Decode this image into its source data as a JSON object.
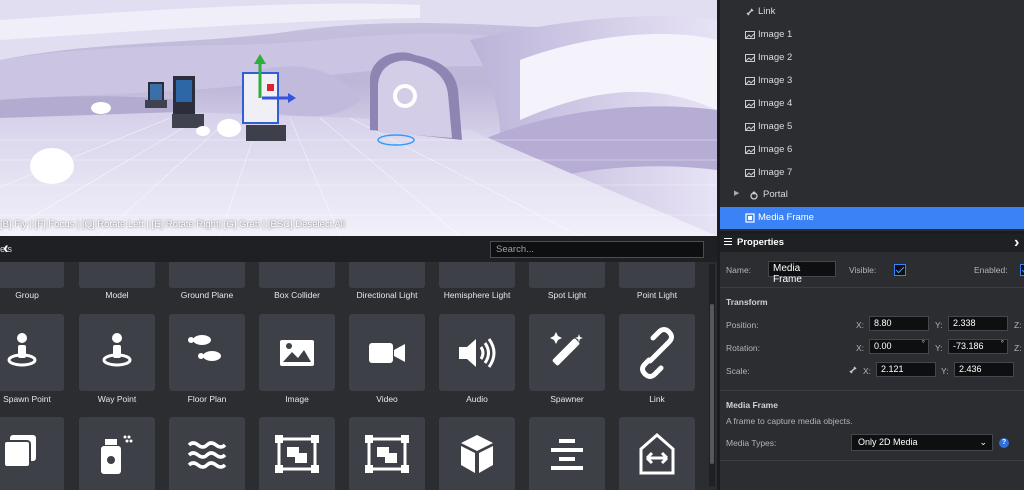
{
  "viewport": {
    "help_text": "[B] Fly | [F] Focus | [Q] Rotate Left | [E] Rotate Right| [G] Grab | [ESC] Deselect All"
  },
  "hierarchy": {
    "items": [
      {
        "label": "Link",
        "icon": "link-icon"
      },
      {
        "label": "Image 1",
        "icon": "image-icon"
      },
      {
        "label": "Image 2",
        "icon": "image-icon"
      },
      {
        "label": "Image 3",
        "icon": "image-icon"
      },
      {
        "label": "Image 4",
        "icon": "image-icon"
      },
      {
        "label": "Image 5",
        "icon": "image-icon"
      },
      {
        "label": "Image 6",
        "icon": "image-icon"
      },
      {
        "label": "Image 7",
        "icon": "image-icon"
      },
      {
        "label": "Portal",
        "icon": "portal-icon"
      },
      {
        "label": "Media Frame",
        "icon": "media-frame-icon",
        "selected": true
      }
    ]
  },
  "properties": {
    "title": "Properties",
    "name_label": "Name:",
    "name_value": "Media Frame",
    "visible_label": "Visible:",
    "enabled_label": "Enabled:",
    "transform_heading": "Transform",
    "position_label": "Position:",
    "rotation_label": "Rotation:",
    "scale_label": "Scale:",
    "x_label": "X:",
    "y_label": "Y:",
    "z_label": "Z:",
    "position": {
      "x": "8.80",
      "y": "2.338"
    },
    "rotation": {
      "x": "0.00",
      "y": "-73.186"
    },
    "scale": {
      "x": "2.121",
      "y": "2.436"
    },
    "degree_symbol": "°",
    "media_frame_heading": "Media Frame",
    "media_frame_desc": "A frame to capture media objects.",
    "media_types_label": "Media Types:",
    "media_types_value": "Only 2D Media",
    "help_symbol": "?"
  },
  "assets": {
    "title": "ets",
    "search_placeholder": "Search...",
    "row1": [
      "Group",
      "Model",
      "Ground Plane",
      "Box Collider",
      "Directional Light",
      "Hemisphere Light",
      "Spot Light",
      "Point Light"
    ],
    "row2": [
      {
        "label": "Spawn Point",
        "icon": "spawn-point-icon"
      },
      {
        "label": "Way Point",
        "icon": "way-point-icon"
      },
      {
        "label": "Floor Plan",
        "icon": "footprints-icon"
      },
      {
        "label": "Image",
        "icon": "image-icon"
      },
      {
        "label": "Video",
        "icon": "video-icon"
      },
      {
        "label": "Audio",
        "icon": "audio-icon"
      },
      {
        "label": "Spawner",
        "icon": "magic-wand-icon"
      },
      {
        "label": "Link",
        "icon": "link-icon"
      }
    ],
    "row3": [
      "layers-icon",
      "spray-bottle-icon",
      "water-icon",
      "media-frame-icon",
      "media-frame-icon",
      "cube-icon",
      "align-center-icon",
      "portal-arrows-icon"
    ]
  },
  "colors": {
    "accent": "#3b82f6",
    "panel": "#2b2d31",
    "tile": "#3d4046"
  }
}
